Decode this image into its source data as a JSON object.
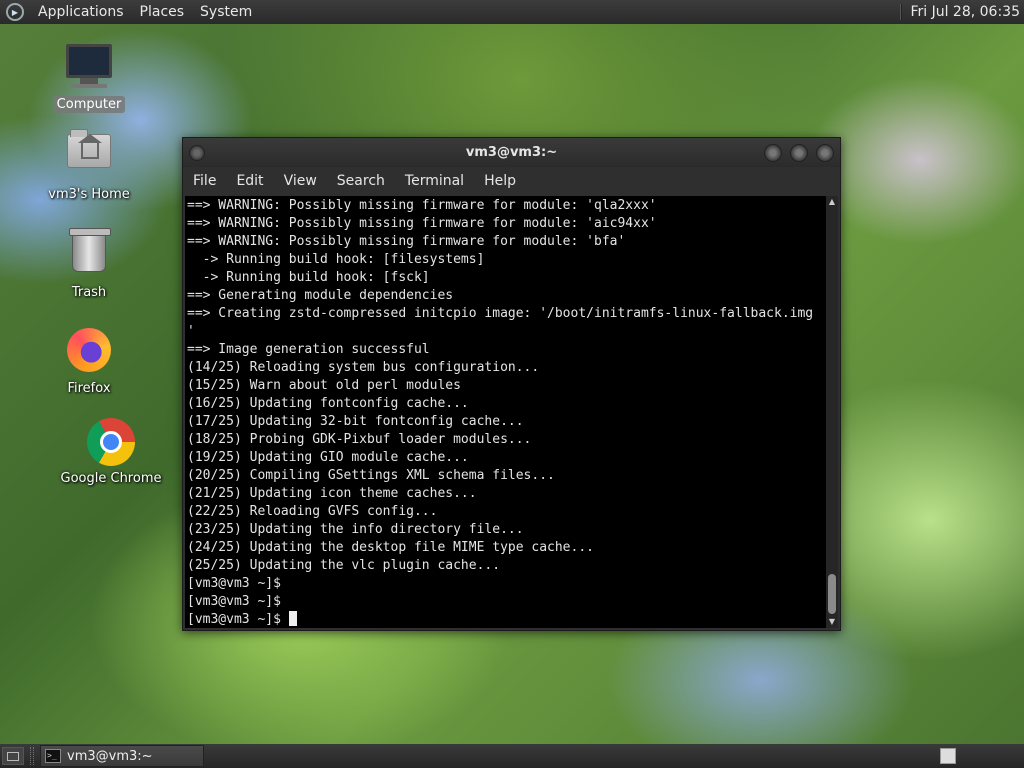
{
  "top_panel": {
    "menus": [
      "Applications",
      "Places",
      "System"
    ],
    "clock": "Fri Jul 28, 06:35"
  },
  "desktop_icons": [
    {
      "label": "Computer",
      "icon": "computer-icon"
    },
    {
      "label": "vm3's Home",
      "icon": "home-folder-icon"
    },
    {
      "label": "Trash",
      "icon": "trash-icon"
    },
    {
      "label": "Firefox",
      "icon": "firefox-icon"
    },
    {
      "label": "Google Chrome",
      "icon": "chrome-icon"
    }
  ],
  "terminal": {
    "title": "vm3@vm3:~",
    "menu": [
      "File",
      "Edit",
      "View",
      "Search",
      "Terminal",
      "Help"
    ],
    "lines": [
      "==> WARNING: Possibly missing firmware for module: 'qla2xxx'",
      "==> WARNING: Possibly missing firmware for module: 'aic94xx'",
      "==> WARNING: Possibly missing firmware for module: 'bfa'",
      "  -> Running build hook: [filesystems]",
      "  -> Running build hook: [fsck]",
      "==> Generating module dependencies",
      "==> Creating zstd-compressed initcpio image: '/boot/initramfs-linux-fallback.img",
      "'",
      "==> Image generation successful",
      "(14/25) Reloading system bus configuration...",
      "(15/25) Warn about old perl modules",
      "(16/25) Updating fontconfig cache...",
      "(17/25) Updating 32-bit fontconfig cache...",
      "(18/25) Probing GDK-Pixbuf loader modules...",
      "(19/25) Updating GIO module cache...",
      "(20/25) Compiling GSettings XML schema files...",
      "(21/25) Updating icon theme caches...",
      "(22/25) Reloading GVFS config...",
      "(23/25) Updating the info directory file...",
      "(24/25) Updating the desktop file MIME type cache...",
      "(25/25) Updating the vlc plugin cache...",
      "[vm3@vm3 ~]$",
      "[vm3@vm3 ~]$",
      "[vm3@vm3 ~]$ "
    ]
  },
  "taskbar": {
    "task_label": "vm3@vm3:~"
  }
}
